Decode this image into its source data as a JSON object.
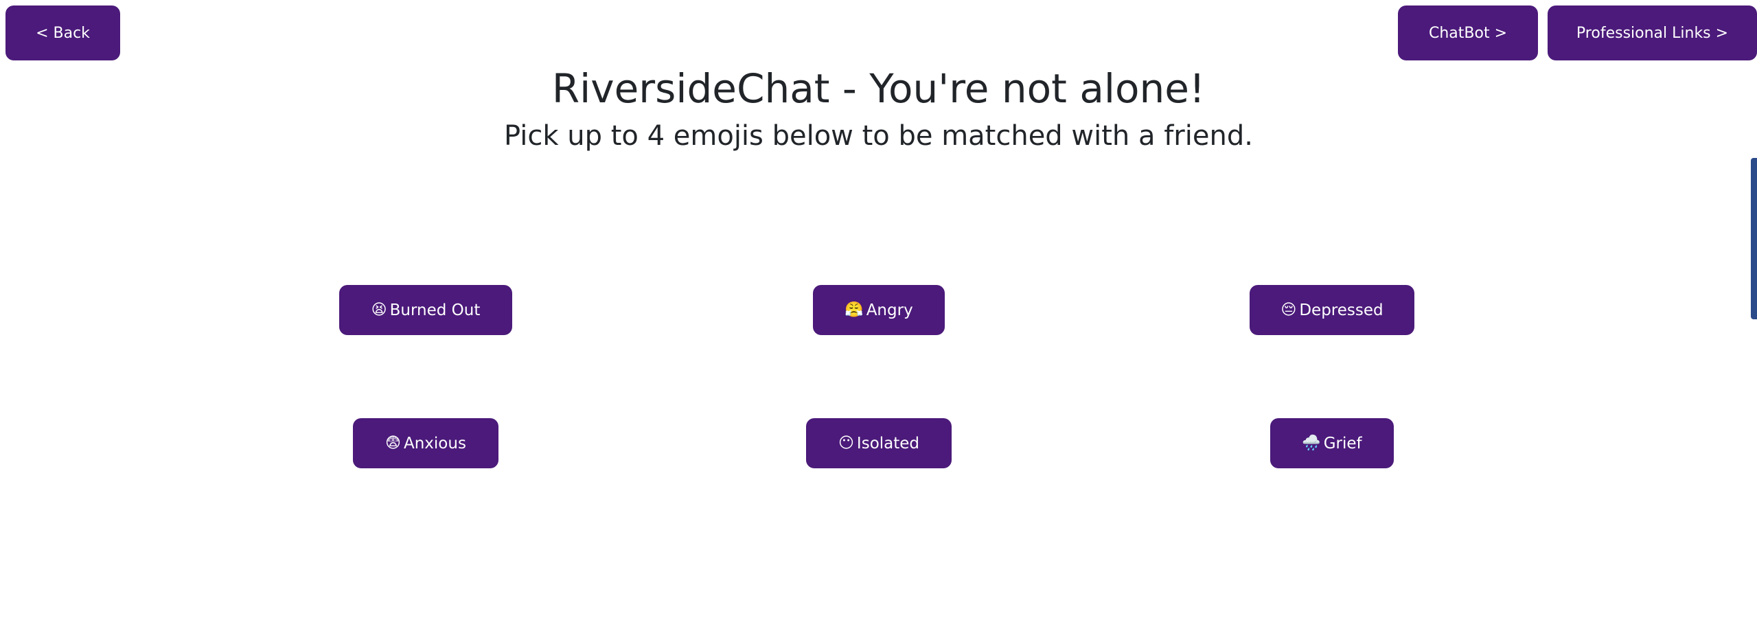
{
  "nav": {
    "back_label": "< Back",
    "chatbot_label": "ChatBot >",
    "professional_links_label": "Professional Links >"
  },
  "header": {
    "title": "RiversideChat - You're not alone!",
    "subtitle": "Pick up to 4 emojis below to be matched with a friend."
  },
  "emotions": [
    {
      "emoji": "😫",
      "label": "Burned Out",
      "icon": "tired-face-icon"
    },
    {
      "emoji": "😤",
      "label": "Angry",
      "icon": "steam-face-icon"
    },
    {
      "emoji": "😔",
      "label": "Depressed",
      "icon": "pensive-face-icon"
    },
    {
      "emoji": "😨",
      "label": "Anxious",
      "icon": "fearful-face-icon"
    },
    {
      "emoji": "😶",
      "label": "Isolated",
      "icon": "no-mouth-face-icon"
    },
    {
      "emoji": "🌧️",
      "label": "Grief",
      "icon": "rain-cloud-icon"
    }
  ],
  "colors": {
    "button_bg": "#4b1a7a",
    "button_text": "#ffffff",
    "heading_text": "#212529",
    "edge_accent": "#2b4a8a"
  }
}
